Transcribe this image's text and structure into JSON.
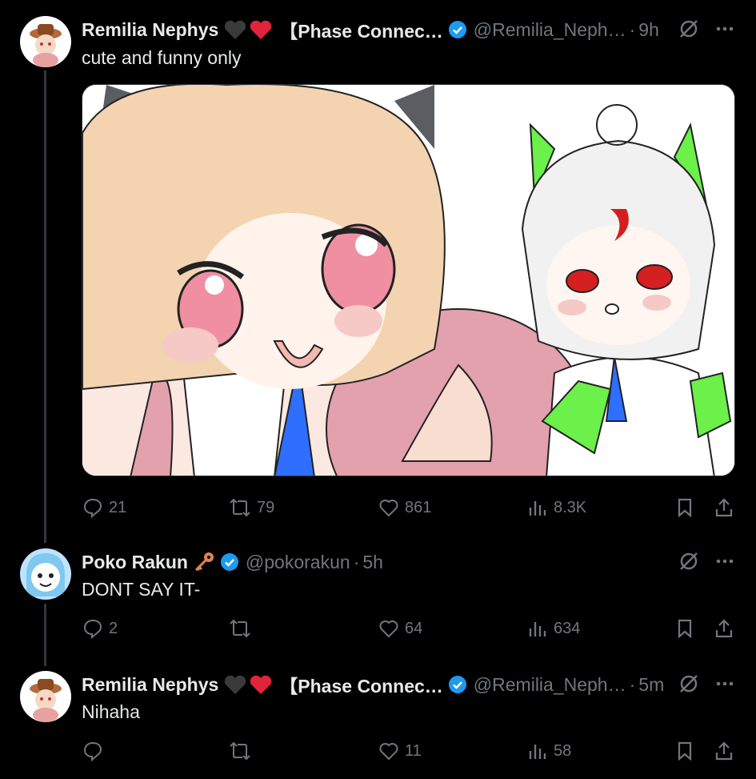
{
  "tweets": [
    {
      "name": "Remilia Nephys",
      "affiliation": "【Phase Connec…",
      "handle": "@Remilia_Neph…",
      "time": "9h",
      "text": "cute and funny only",
      "stats": {
        "replies": "21",
        "reposts": "79",
        "likes": "861",
        "views": "8.3K"
      }
    },
    {
      "name": "Poko Rakun",
      "handle": "@pokorakun",
      "time": "5h",
      "text": "DONT SAY IT-",
      "stats": {
        "replies": "2",
        "reposts": "",
        "likes": "64",
        "views": "634"
      }
    },
    {
      "name": "Remilia Nephys",
      "affiliation": "【Phase Connec…",
      "handle": "@Remilia_Neph…",
      "time": "5m",
      "text": "Nihaha",
      "stats": {
        "replies": "",
        "reposts": "",
        "likes": "11",
        "views": "58"
      }
    }
  ],
  "icons": {
    "separator": "·",
    "more": "more-icon",
    "grok": "grok-icon",
    "verified": "verified-badge-icon",
    "reply": "reply-icon",
    "repost": "repost-icon",
    "like": "like-icon",
    "views": "views-icon",
    "bookmark": "bookmark-icon",
    "share": "share-icon"
  },
  "colors": {
    "verified": "#1d9bf0",
    "muted": "#71767b",
    "text": "#e7e9ea",
    "heart_red": "#e0243a"
  }
}
